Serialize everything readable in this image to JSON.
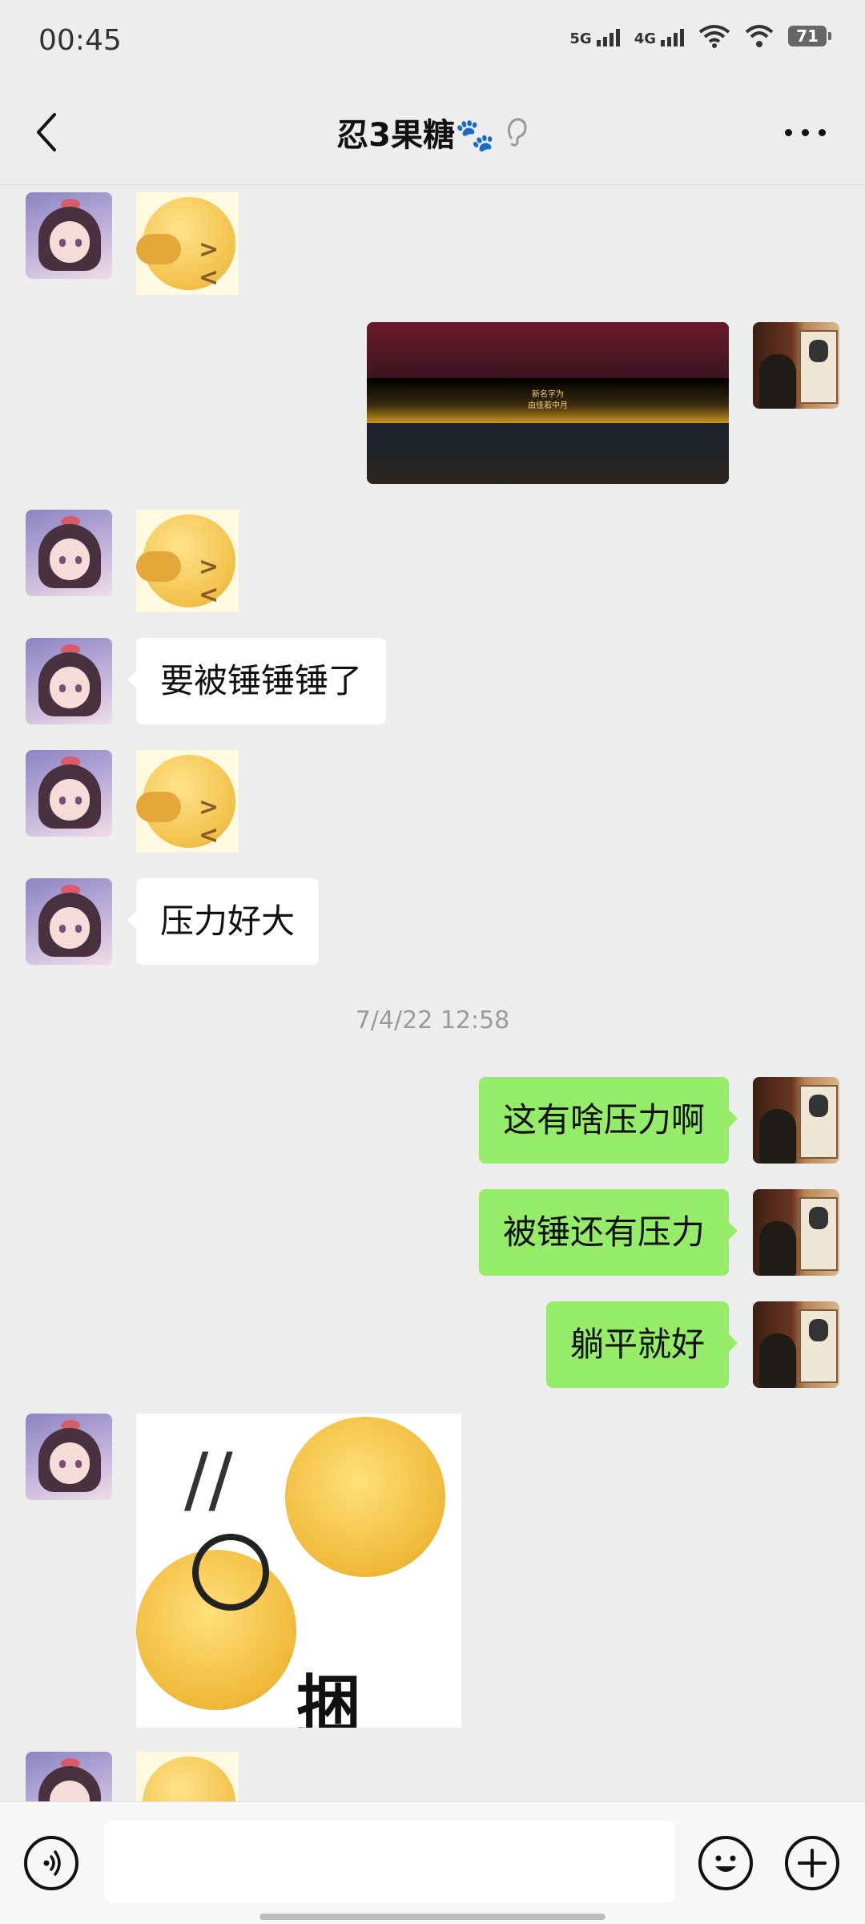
{
  "status_bar": {
    "time": "00:45",
    "network_1": "5G",
    "network_2": "4G",
    "battery": "71"
  },
  "header": {
    "title": "忍3果糖🐾",
    "icons": [
      "back-arrow-icon",
      "ear-icon",
      "more-dots-icon"
    ]
  },
  "messages": [
    {
      "from": "other",
      "type": "sticker"
    },
    {
      "from": "me",
      "type": "image"
    },
    {
      "from": "other",
      "type": "sticker"
    },
    {
      "from": "other",
      "type": "text",
      "text": "要被锤锤锤了"
    },
    {
      "from": "other",
      "type": "sticker"
    },
    {
      "from": "other",
      "type": "text",
      "text": "压力好大"
    },
    {
      "type": "timestamp",
      "text": "7/4/22 12:58"
    },
    {
      "from": "me",
      "type": "text",
      "text": "这有啥压力啊"
    },
    {
      "from": "me",
      "type": "text",
      "text": "被锤还有压力"
    },
    {
      "from": "me",
      "type": "text",
      "text": "躺平就好"
    },
    {
      "from": "other",
      "type": "sticker"
    },
    {
      "from": "other",
      "type": "sticker"
    }
  ],
  "screenshot_text": {
    "line1": "新名字为",
    "line2": "由佳若中月"
  },
  "big_sticker_text": "捆",
  "bottom_bar": {
    "icons": [
      "voice-icon",
      "emoji-icon",
      "plus-icon"
    ]
  },
  "colors": {
    "background": "#ededed",
    "my_bubble": "#95ec69",
    "other_bubble": "#ffffff"
  }
}
